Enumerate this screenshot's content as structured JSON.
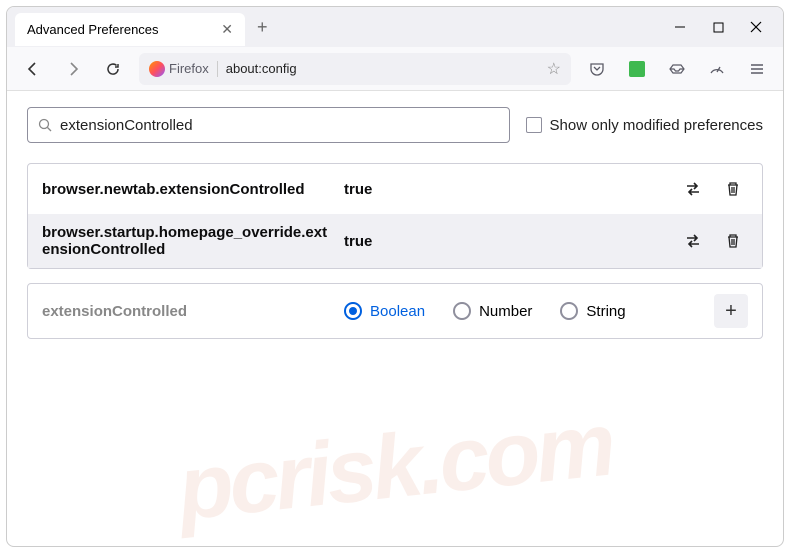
{
  "tab": {
    "title": "Advanced Preferences"
  },
  "address": {
    "context": "Firefox",
    "url": "about:config"
  },
  "search": {
    "value": "extensionControlled",
    "checkbox_label": "Show only modified preferences"
  },
  "prefs": [
    {
      "name": "browser.newtab.extensionControlled",
      "value": "true"
    },
    {
      "name": "browser.startup.homepage_override.extensionControlled",
      "value": "true"
    }
  ],
  "new_pref": {
    "name": "extensionControlled",
    "types": [
      "Boolean",
      "Number",
      "String"
    ],
    "selected": 0
  },
  "watermark": "pcrisk.com"
}
